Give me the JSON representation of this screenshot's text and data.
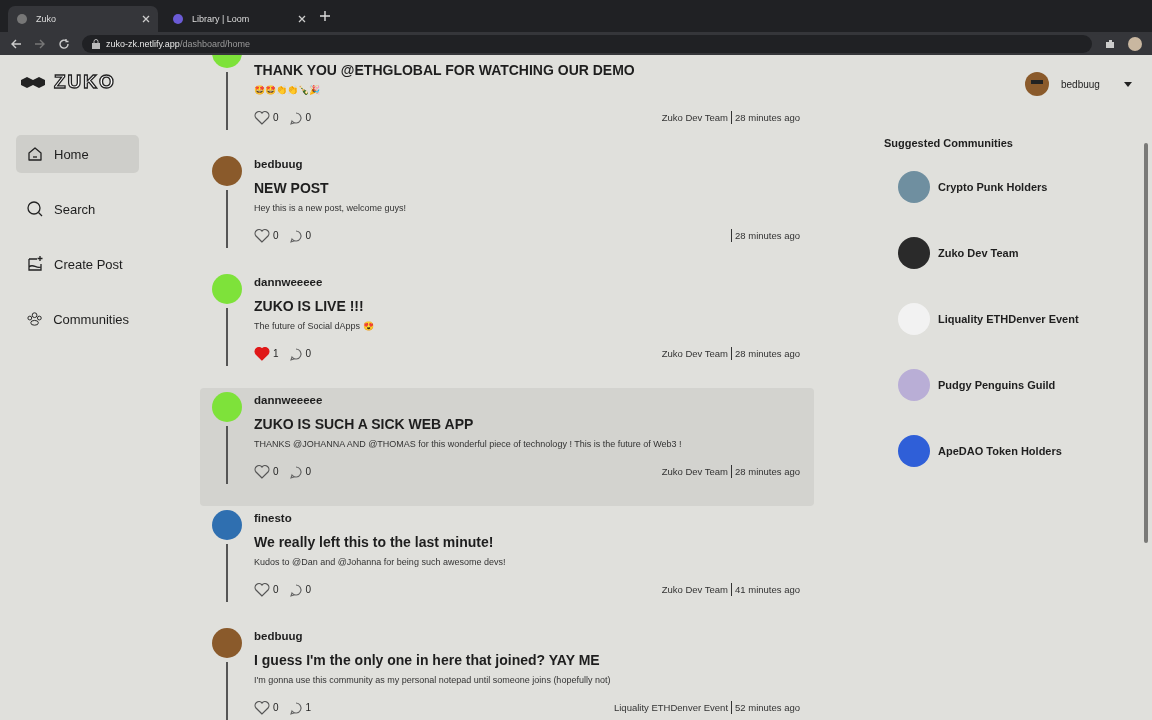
{
  "browser": {
    "tabs": [
      {
        "title": "Zuko",
        "selected": true
      },
      {
        "title": "Library | Loom",
        "selected": false
      }
    ],
    "url_host": "zuko-zk.netlify.app",
    "url_path": "/dashboard/home"
  },
  "logo": {
    "text": "ZUKO"
  },
  "nav": [
    {
      "label": "Home",
      "selected": true
    },
    {
      "label": "Search",
      "selected": false
    },
    {
      "label": "Create Post",
      "selected": false
    },
    {
      "label": "Communities",
      "selected": false
    }
  ],
  "posts": [
    {
      "title": "THANK YOU @ETHGLOBAL FOR WATCHING OUR DEMO",
      "body": "🤩🤩👏👏🍾🎉",
      "likes": "0",
      "comments": "0",
      "liked": false,
      "highlighted": false,
      "community": "Zuko Dev Team",
      "time": "28 minutes ago"
    },
    {
      "author": "bedbuug",
      "title": "NEW POST",
      "body": "Hey this is a new post, welcome guys!",
      "likes": "0",
      "comments": "0",
      "liked": false,
      "highlighted": false,
      "time": "28 minutes ago"
    },
    {
      "author": "dannweeeee",
      "title": "ZUKO IS LIVE !!!",
      "body": "The future of Social dApps 😍",
      "likes": "1",
      "comments": "0",
      "liked": true,
      "highlighted": false,
      "community": "Zuko Dev Team",
      "time": "28 minutes ago"
    },
    {
      "author": "dannweeeee",
      "title": "ZUKO IS SUCH A SICK WEB APP",
      "body": "THANKS @JOHANNA AND @THOMAS for this wonderful piece of technology ! This is the future of Web3 !",
      "likes": "0",
      "comments": "0",
      "liked": false,
      "highlighted": true,
      "community": "Zuko Dev Team",
      "time": "28 minutes ago"
    },
    {
      "author": "finesto",
      "title": "We really left this to the last minute!",
      "body": "Kudos to @Dan and @Johanna for being such awesome devs!",
      "likes": "0",
      "comments": "0",
      "liked": false,
      "highlighted": false,
      "community": "Zuko Dev Team",
      "time": "41 minutes ago"
    },
    {
      "author": "bedbuug",
      "title": "I guess I'm the only one in here that joined? YAY ME",
      "body": "I'm gonna use this community as my personal notepad until someone joins (hopefully not)",
      "likes": "0",
      "comments": "1",
      "liked": false,
      "highlighted": false,
      "community": "Liquality ETHDenver Event",
      "time": "52 minutes ago"
    }
  ],
  "user": {
    "name": "bedbuug"
  },
  "suggested": {
    "heading": "Suggested Communities",
    "items": [
      {
        "name": "Crypto Punk Holders",
        "color": "#6f8fa0"
      },
      {
        "name": "Zuko Dev Team",
        "color": "#2a2a2a"
      },
      {
        "name": "Liquality ETHDenver Event",
        "color": "#f2f2f2"
      },
      {
        "name": "Pudgy Penguins Guild",
        "color": "#b9aed6"
      },
      {
        "name": "ApeDAO Token Holders",
        "color": "#2f5fd8"
      }
    ]
  }
}
